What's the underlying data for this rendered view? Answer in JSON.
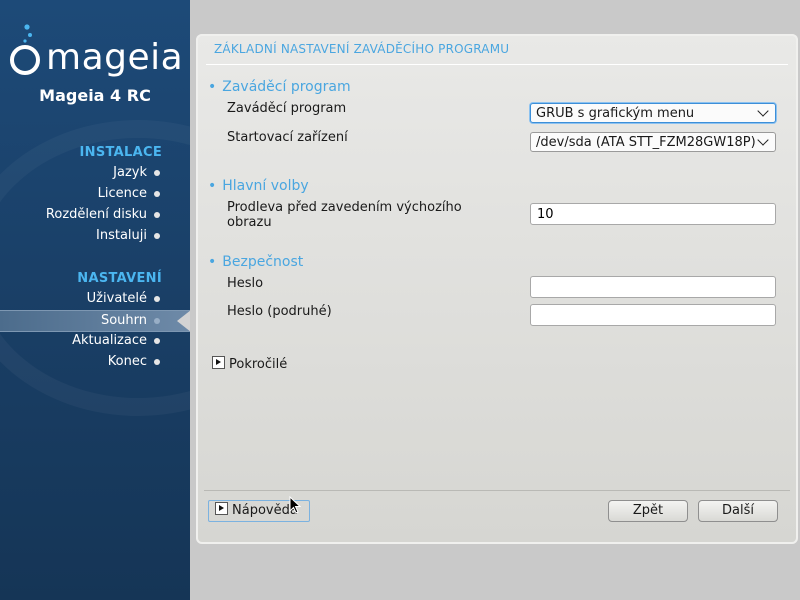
{
  "sidebar": {
    "logo_text": "mageia",
    "product": "Mageia 4 RC",
    "sections": [
      {
        "title": "INSTALACE",
        "items": [
          "Jazyk",
          "Licence",
          "Rozdělení disku",
          "Instaluji"
        ]
      },
      {
        "title": "NASTAVENÍ",
        "items": [
          "Uživatelé",
          "Souhrn",
          "Aktualizace",
          "Konec"
        ]
      }
    ],
    "active_item": "Souhrn"
  },
  "main": {
    "title": "ZÁKLADNÍ NASTAVENÍ ZAVÁDĚCÍHO PROGRAMU",
    "groups": [
      {
        "title": "Zaváděcí program",
        "rows": [
          {
            "label": "Zaváděcí program",
            "type": "combo",
            "value": "GRUB s grafickým menu"
          },
          {
            "label": "Startovací zařízení",
            "type": "combo",
            "value": "/dev/sda (ATA STT_FZM28GW18P)"
          }
        ]
      },
      {
        "title": "Hlavní volby",
        "rows": [
          {
            "label": "Prodleva před zavedením výchozího obrazu",
            "type": "input",
            "value": "10"
          }
        ]
      },
      {
        "title": "Bezpečnost",
        "rows": [
          {
            "label": "Heslo",
            "type": "password",
            "value": ""
          },
          {
            "label": "Heslo (podruhé)",
            "type": "password",
            "value": ""
          }
        ]
      }
    ],
    "advanced_label": "Pokročilé",
    "help_label": "Nápověda",
    "back_label": "Zpět",
    "next_label": "Další"
  },
  "colors": {
    "sidebar_bg": "#1a4068",
    "accent": "#4aa6e0",
    "section_title": "#4bb6f0"
  }
}
